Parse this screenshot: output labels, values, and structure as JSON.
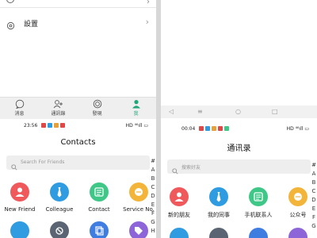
{
  "left": {
    "settings": {
      "label": "設置"
    },
    "tabs": [
      {
        "label": "消息",
        "icon": "chat-bubble-icon",
        "active": false
      },
      {
        "label": "通訊錄",
        "icon": "contacts-icon",
        "active": false
      },
      {
        "label": "發現",
        "icon": "discover-icon",
        "active": false
      },
      {
        "label": "我",
        "icon": "person-icon",
        "active": true
      }
    ],
    "status": {
      "time": "23:56",
      "right": "HD ⁴⁶ıll ▭"
    },
    "title": "Contacts",
    "search": {
      "placeholder": "Search For Friends"
    },
    "index": [
      "#",
      "A",
      "B",
      "C",
      "D",
      "E",
      "F",
      "G",
      "H"
    ],
    "items": [
      {
        "label": "New Friend",
        "color": "#f0595c",
        "icon": "person-add-icon"
      },
      {
        "label": "Colleague",
        "color": "#2f9be0",
        "icon": "tie-icon"
      },
      {
        "label": "Contact",
        "color": "#3ec787",
        "icon": "contact-card-icon"
      },
      {
        "label": "Service No.",
        "color": "#f3b43a",
        "icon": "service-icon"
      }
    ],
    "row2_colors": [
      "#2f9be0",
      "#5a6473",
      "#3f7de0",
      "#8e65d8"
    ]
  },
  "right": {
    "status": {
      "time": "00:04",
      "right": "HD ⁴⁶ıll ▭"
    },
    "title": "通讯录",
    "search": {
      "placeholder": "搜索好友"
    },
    "index": [
      "#",
      "A",
      "B",
      "C",
      "D",
      "E",
      "F",
      "G"
    ],
    "items": [
      {
        "label": "新的朋友",
        "color": "#f0595c",
        "icon": "person-add-icon"
      },
      {
        "label": "我的同事",
        "color": "#2f9be0",
        "icon": "tie-icon"
      },
      {
        "label": "手机联系人",
        "color": "#3ec787",
        "icon": "contact-card-icon"
      },
      {
        "label": "公众号",
        "color": "#f3b43a",
        "icon": "service-icon"
      }
    ],
    "row2_colors": [
      "#2f9be0",
      "#5a6473",
      "#3f7de0",
      "#8e65d8"
    ],
    "nav": {
      "back": "◁",
      "home": "○",
      "recent": "□",
      "menu": "≡"
    }
  }
}
